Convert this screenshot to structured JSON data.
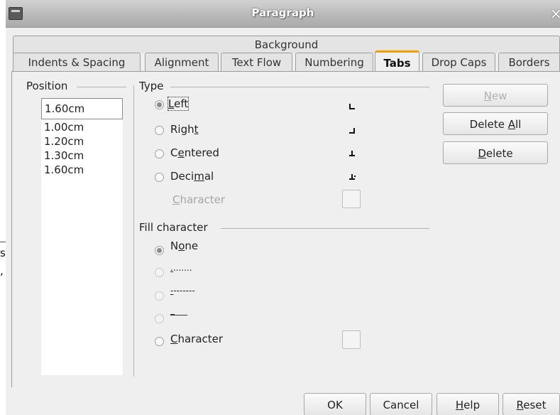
{
  "background_window": {
    "text_line1": "s",
    "text_line2": ","
  },
  "window": {
    "title": "Paragraph",
    "close_glyph": "×"
  },
  "tabs": {
    "background_tab": "Background",
    "row": [
      "Indents & Spacing",
      "Alignment",
      "Text Flow",
      "Numbering",
      "Tabs",
      "Drop Caps",
      "Borders"
    ],
    "active": "Tabs"
  },
  "position": {
    "label": "Position",
    "input_value": "1.60cm",
    "items": [
      "1.00cm",
      "1.20cm",
      "1.30cm",
      "1.60cm"
    ]
  },
  "type_group": {
    "label": "Type",
    "options": [
      {
        "pre": "",
        "ul": "L",
        "post": "eft",
        "checked": true,
        "glyph": "left-tab-icon"
      },
      {
        "pre": "Righ",
        "ul": "t",
        "post": "",
        "checked": false,
        "glyph": "right-tab-icon"
      },
      {
        "pre": "C",
        "ul": "e",
        "post": "ntered",
        "checked": false,
        "glyph": "center-tab-icon"
      },
      {
        "pre": "Deci",
        "ul": "m",
        "post": "al",
        "checked": false,
        "glyph": "decimal-tab-icon"
      }
    ],
    "character": {
      "pre": "",
      "ul": "C",
      "post": "haracter",
      "disabled": true
    }
  },
  "fill_group": {
    "label": "Fill character",
    "options": [
      {
        "pre": "N",
        "ul": "o",
        "post": "ne",
        "checked": true,
        "disabled": false
      },
      {
        "pre": "",
        "ul": ".",
        "post": ".......",
        "checked": false,
        "disabled": true
      },
      {
        "pre": "",
        "ul": "-",
        "post": "-------",
        "checked": false,
        "disabled": true
      },
      {
        "pre": "",
        "ul": "_",
        "post": "___",
        "checked": false,
        "disabled": true
      }
    ],
    "character": {
      "pre": "",
      "ul": "C",
      "post": "haracter",
      "disabled": false
    }
  },
  "side_buttons": {
    "new": {
      "pre": "",
      "ul": "N",
      "post": "ew",
      "disabled": true
    },
    "delete_all": {
      "pre": "Delete ",
      "ul": "A",
      "post": "ll"
    },
    "delete": {
      "pre": "",
      "ul": "D",
      "post": "elete"
    }
  },
  "footer_buttons": {
    "ok": "OK",
    "cancel": "Cancel",
    "help": {
      "pre": "",
      "ul": "H",
      "post": "elp"
    },
    "reset": {
      "pre": "",
      "ul": "R",
      "post": "eset"
    }
  },
  "colors": {
    "active_tab_accent": "#f0a000",
    "disabled_text": "#a6a6a6"
  }
}
